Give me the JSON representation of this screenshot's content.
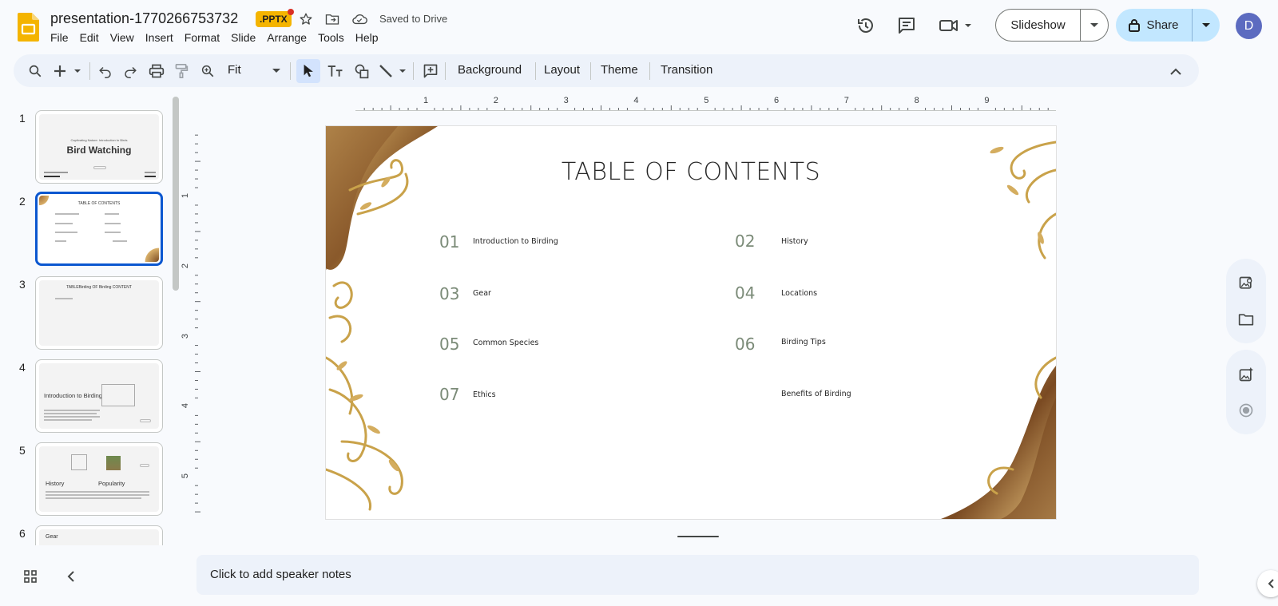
{
  "header": {
    "doc_title": "presentation-1770266753732",
    "file_badge": ".PPTX",
    "saved_status": "Saved to Drive",
    "menu": [
      "File",
      "Edit",
      "View",
      "Insert",
      "Format",
      "Slide",
      "Arrange",
      "Tools",
      "Help"
    ],
    "slideshow_label": "Slideshow",
    "share_label": "Share",
    "avatar_initial": "D"
  },
  "toolbar": {
    "zoom_value": "Fit",
    "background_label": "Background",
    "layout_label": "Layout",
    "theme_label": "Theme",
    "transition_label": "Transition"
  },
  "ruler": {
    "h_labels": [
      "1",
      "2",
      "3",
      "4",
      "5",
      "6",
      "7",
      "8",
      "9"
    ],
    "v_labels": [
      "1",
      "2",
      "3",
      "4",
      "5"
    ]
  },
  "filmstrip": {
    "slides": [
      {
        "num": "1",
        "title": "Bird Watching",
        "subtitle": "Captivating Nature: Introduction to Birds"
      },
      {
        "num": "2",
        "title": "TABLE OF CONTENTS"
      },
      {
        "num": "3",
        "title": "TABLEBirding OF Birding CONTENT"
      },
      {
        "num": "4",
        "title": "Introduction to Birding"
      },
      {
        "num": "5",
        "title_left": "History",
        "title_right": "Popularity"
      },
      {
        "num": "6",
        "title": "Gear"
      }
    ]
  },
  "slide": {
    "title": "TABLE OF CONTENTS",
    "items": [
      {
        "num": "01",
        "label": "Introduction to Birding"
      },
      {
        "num": "02",
        "label": "History"
      },
      {
        "num": "03",
        "label": "Gear"
      },
      {
        "num": "04",
        "label": "Locations"
      },
      {
        "num": "05",
        "label": "Common Species"
      },
      {
        "num": "06",
        "label": "Birding Tips"
      },
      {
        "num": "07",
        "label": "Ethics"
      },
      {
        "num": "",
        "label": "Benefits of Birding"
      }
    ]
  },
  "notes": {
    "placeholder": "Click to add speaker notes"
  },
  "colors": {
    "accent": "#0b57d0",
    "share_bg": "#c2e7ff",
    "badge": "#f4b400",
    "toc_number": "#7b8b78",
    "gold": "#c9a24a",
    "bronze": "#8a5a2b"
  }
}
